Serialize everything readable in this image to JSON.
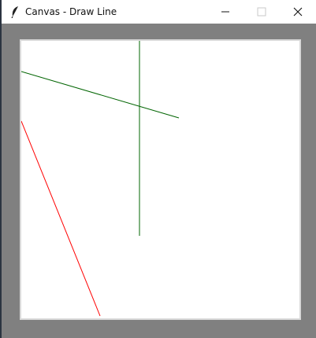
{
  "window": {
    "title": "Canvas - Draw Line",
    "icons": {
      "app": "feather-icon",
      "minimize": "minimize-icon",
      "maximize": "maximize-icon",
      "close": "close-icon"
    }
  },
  "colors": {
    "client_background": "#808080",
    "canvas_background": "#ffffff",
    "green_line": "#006400",
    "red_line": "#ff0000"
  }
}
